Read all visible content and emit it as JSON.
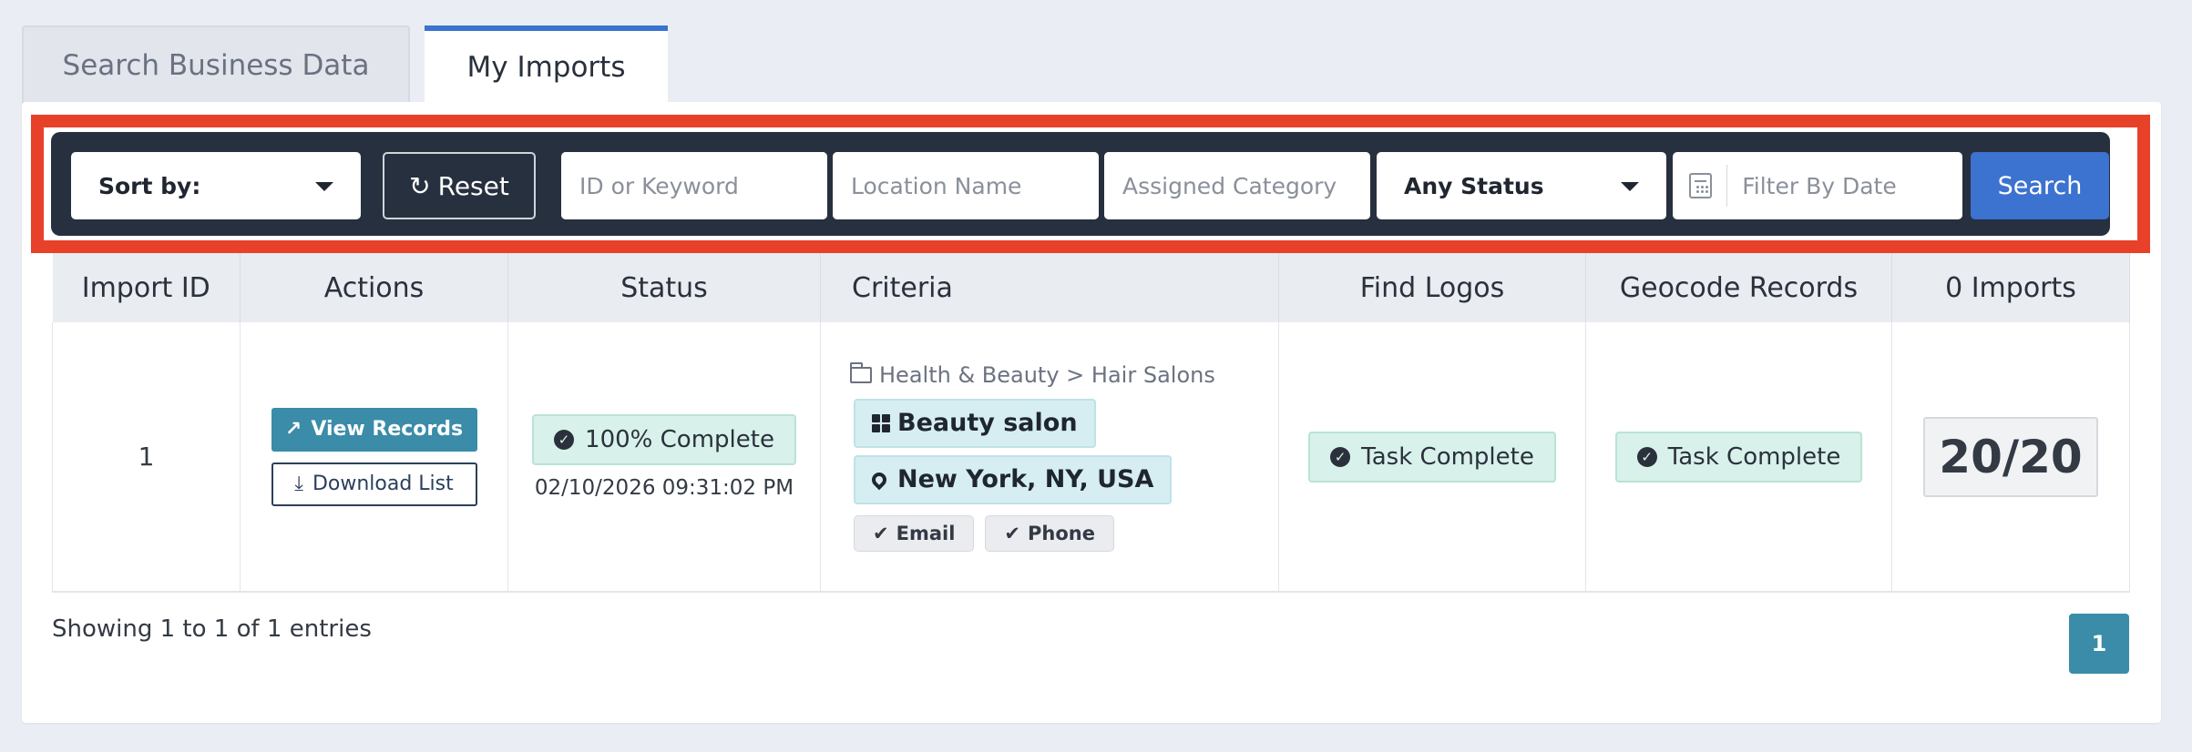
{
  "tabs": [
    {
      "label": "Search Business Data",
      "active": false
    },
    {
      "label": "My Imports",
      "active": true
    }
  ],
  "filters": {
    "sort_label": "Sort by:",
    "reset_label": "Reset",
    "keyword_placeholder": "ID or Keyword",
    "location_placeholder": "Location Name",
    "category_placeholder": "Assigned Category",
    "status_label": "Any Status",
    "date_placeholder": "Filter By Date",
    "search_label": "Search"
  },
  "table": {
    "headers": [
      "Import ID",
      "Actions",
      "Status",
      "Criteria",
      "Find Logos",
      "Geocode Records",
      "0 Imports"
    ],
    "rows": [
      {
        "import_id": "1",
        "view_label": "View Records",
        "download_label": "Download List",
        "status": "100% Complete",
        "status_date": "02/10/2026 09:31:02 PM",
        "criteria_path": "Health & Beauty > Hair Salons",
        "criteria_category": "Beauty salon",
        "criteria_location": "New York, NY, USA",
        "criteria_email": "Email",
        "criteria_phone": "Phone",
        "find_logos": "Task Complete",
        "geocode": "Task Complete",
        "imports": "20/20"
      }
    ]
  },
  "footer": {
    "entries_text": "Showing 1 to 1 of 1 entries",
    "current_page": "1"
  },
  "colors": {
    "accent": "#3c72d0",
    "highlight": "#e8412a",
    "filterbar_bg": "#27303f",
    "teal": "#3a8ca8"
  }
}
